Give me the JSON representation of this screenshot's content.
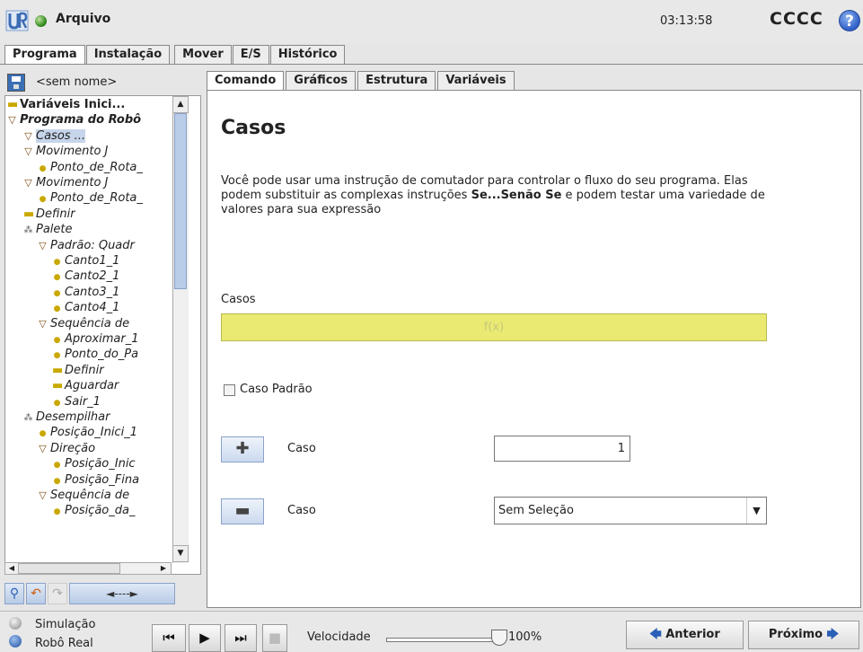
{
  "topbar": {
    "file_label": "Arquivo",
    "clock": "03:13:58",
    "robot_name": "CCCC",
    "help_icon": "?"
  },
  "main_tabs": [
    "Programa",
    "Instalação",
    "Mover",
    "E/S",
    "Histórico"
  ],
  "left": {
    "program_name": "<sem nome>",
    "tree": [
      {
        "label": "Variáveis Inici...",
        "icon": "variables-bar-icon",
        "level": 0
      },
      {
        "label": "Programa do Robô",
        "icon": "triangle-icon",
        "level": 0
      },
      {
        "label": "Casos ...",
        "icon": "triangle-icon",
        "level": 1,
        "selected": true
      },
      {
        "label": "Movimento J",
        "icon": "triangle-icon",
        "level": 1
      },
      {
        "label": "Ponto_de_Rota_",
        "icon": "waypoint-icon",
        "level": 2
      },
      {
        "label": "Movimento J",
        "icon": "triangle-icon",
        "level": 1
      },
      {
        "label": "Ponto_de_Rota_",
        "icon": "waypoint-icon",
        "level": 2
      },
      {
        "label": "Definir",
        "icon": "bar-icon",
        "level": 1
      },
      {
        "label": "Palete",
        "icon": "pallet-icon",
        "level": 1
      },
      {
        "label": "Padrão: Quadr",
        "icon": "triangle-icon",
        "level": 2
      },
      {
        "label": "Canto1_1",
        "icon": "waypoint-icon",
        "level": 3
      },
      {
        "label": "Canto2_1",
        "icon": "waypoint-icon",
        "level": 3
      },
      {
        "label": "Canto3_1",
        "icon": "waypoint-icon",
        "level": 3
      },
      {
        "label": "Canto4_1",
        "icon": "waypoint-icon",
        "level": 3
      },
      {
        "label": "Sequência de",
        "icon": "triangle-icon",
        "level": 2
      },
      {
        "label": "Aproximar_1",
        "icon": "waypoint-icon",
        "level": 3
      },
      {
        "label": "Ponto_do_Pa",
        "icon": "waypoint-icon",
        "level": 3
      },
      {
        "label": "Definir",
        "icon": "bar-icon",
        "level": 3
      },
      {
        "label": "Aguardar",
        "icon": "bar-icon",
        "level": 3
      },
      {
        "label": "Sair_1",
        "icon": "waypoint-icon",
        "level": 3
      },
      {
        "label": "Desempilhar",
        "icon": "pallet-icon",
        "level": 1
      },
      {
        "label": "Posição_Inici_1",
        "icon": "waypoint-icon",
        "level": 2
      },
      {
        "label": "Direção",
        "icon": "triangle-icon",
        "level": 2
      },
      {
        "label": "Posição_Inic",
        "icon": "waypoint-icon",
        "level": 3
      },
      {
        "label": "Posição_Fina",
        "icon": "waypoint-icon",
        "level": 3
      },
      {
        "label": "Sequência de",
        "icon": "triangle-icon",
        "level": 2
      },
      {
        "label": "Posição_da_",
        "icon": "waypoint-icon",
        "level": 3
      }
    ],
    "tool_arrow": "◄----►"
  },
  "sub_tabs": [
    "Comando",
    "Gráficos",
    "Estrutura",
    "Variáveis"
  ],
  "content": {
    "title": "Casos",
    "desc_1": "Você pode usar uma instrução de comutador para controlar o fluxo do seu programa. Elas podem substituir as complexas instruções ",
    "desc_bold": "Se...Senão Se",
    "desc_2": " e podem testar uma variedade de valores para sua expressão",
    "casos_label": "Casos",
    "expression_placeholder": "f(x)",
    "default_case_label": "Caso Padrão",
    "default_case_checked": false,
    "add_case_label": "Caso",
    "remove_case_label": "Caso",
    "case_value": "1",
    "case_select": "Sem Seleção"
  },
  "bottom": {
    "simulation_label": "Simulação",
    "real_robot_label": "Robô Real",
    "speed_label": "Velocidade",
    "speed_value": "100%",
    "speed_fraction": 1.0,
    "prev_label": "Anterior",
    "next_label": "Próximo"
  }
}
